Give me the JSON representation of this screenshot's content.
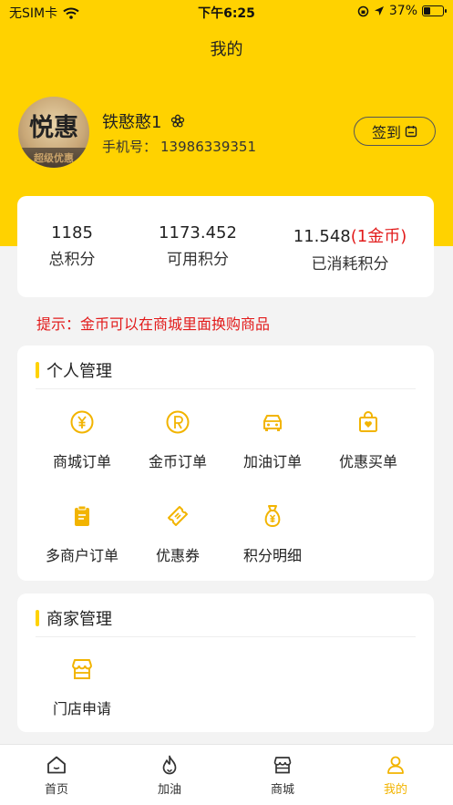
{
  "status_bar": {
    "carrier": "无SIM卡",
    "time": "下午6:25",
    "battery": "37%",
    "battery_level": 0.37
  },
  "nav": {
    "title": "我的"
  },
  "profile": {
    "avatar_text": "悦惠",
    "avatar_subtext": "超级优惠",
    "name": "铁憨憨1",
    "phone_label": "手机号：",
    "phone": "13986339351",
    "checkin_label": "签到"
  },
  "points": {
    "total": {
      "value": "1185",
      "label": "总积分"
    },
    "available": {
      "value": "1173.452",
      "label": "可用积分"
    },
    "consumed": {
      "value": "11.548",
      "extra": "(1金币)",
      "label": "已消耗积分"
    }
  },
  "tip": "提示：金币可以在商城里面换购商品",
  "personal": {
    "title": "个人管理",
    "items": [
      {
        "label": "商城订单",
        "icon": "yen-circle-icon"
      },
      {
        "label": "金币订单",
        "icon": "coin-r-icon"
      },
      {
        "label": "加油订单",
        "icon": "car-icon"
      },
      {
        "label": "优惠买单",
        "icon": "discount-bag-icon"
      },
      {
        "label": "多商户订单",
        "icon": "clipboard-icon"
      },
      {
        "label": "优惠券",
        "icon": "ticket-icon"
      },
      {
        "label": "积分明细",
        "icon": "money-bag-icon"
      }
    ]
  },
  "merchant": {
    "title": "商家管理",
    "items": [
      {
        "label": "门店申请",
        "icon": "store-icon"
      }
    ]
  },
  "tabbar": {
    "items": [
      {
        "label": "首页",
        "icon": "home-icon"
      },
      {
        "label": "加油",
        "icon": "flame-icon"
      },
      {
        "label": "商城",
        "icon": "shop-icon"
      },
      {
        "label": "我的",
        "icon": "person-icon"
      }
    ],
    "active": "我的"
  },
  "colors": {
    "accent": "#ffd200",
    "icon_accent": "#f2b400",
    "alert": "#e21b1b"
  }
}
